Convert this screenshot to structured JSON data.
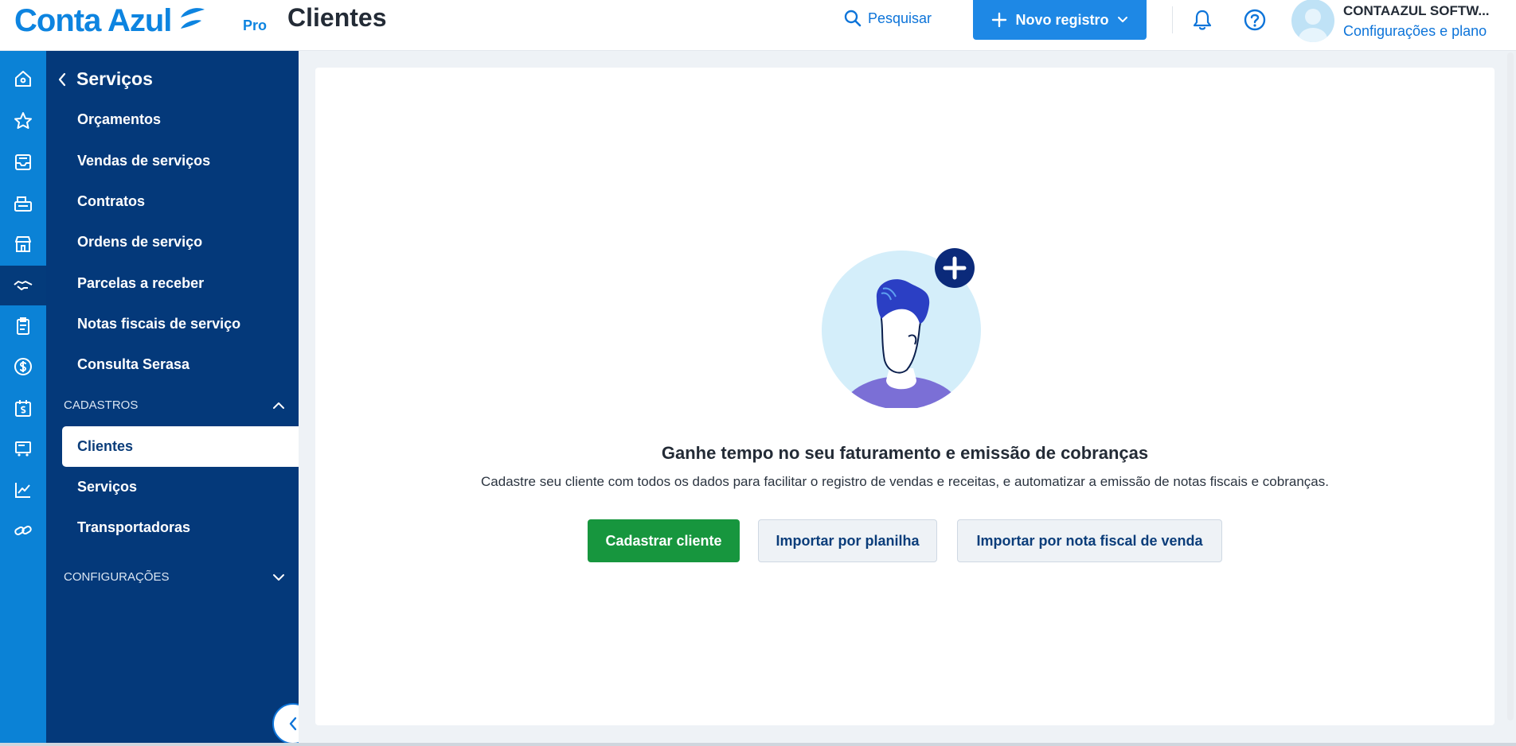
{
  "header": {
    "logo_text": "Conta Azul",
    "logo_pro": "Pro",
    "page_title": "Clientes",
    "search_label": "Pesquisar",
    "new_record_label": "Novo registro",
    "company_name": "CONTAAZUL SOFTW...",
    "config_link": "Configurações e plano"
  },
  "rail": {
    "icons": [
      "home-icon",
      "star-icon",
      "inbox-icon",
      "cash-register-icon",
      "store-icon",
      "handshake-icon",
      "clipboard-icon",
      "dollar-icon",
      "calendar-dollar-icon",
      "cart-icon",
      "chart-icon",
      "link-icon"
    ],
    "active_index": 5
  },
  "menu": {
    "back_label": "Serviços",
    "items": [
      "Orçamentos",
      "Vendas de serviços",
      "Contratos",
      "Ordens de serviço",
      "Parcelas a receber",
      "Notas fiscais de serviço",
      "Consulta Serasa"
    ],
    "section_cadastros": "CADASTROS",
    "cadastros_items": [
      "Clientes",
      "Serviços",
      "Transportadoras"
    ],
    "active_item": "Clientes",
    "section_config": "CONFIGURAÇÕES"
  },
  "empty_state": {
    "title": "Ganhe tempo no seu faturamento e emissão de cobranças",
    "description": "Cadastre seu cliente com todos os dados para facilitar o registro de vendas e receitas, e automatizar a emissão de notas fiscais e cobranças.",
    "primary_button": "Cadastrar cliente",
    "import_sheet_button": "Importar por planilha",
    "import_invoice_button": "Importar por nota fiscal de venda"
  },
  "colors": {
    "brand_blue": "#0d84e0",
    "menu_bg": "#04397a",
    "rail_bg": "#0b82d6",
    "primary_green": "#17963e"
  }
}
